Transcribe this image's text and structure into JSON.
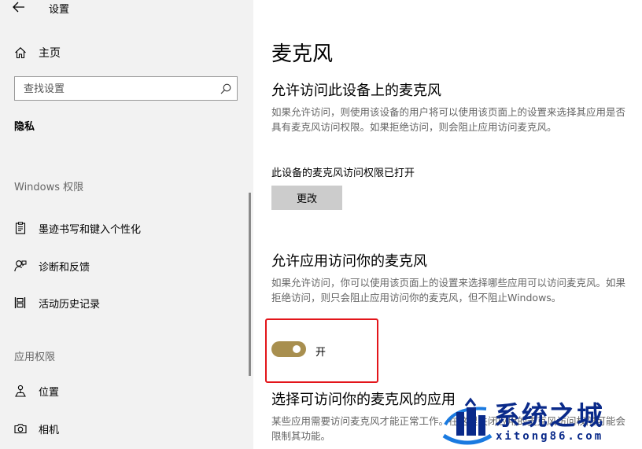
{
  "window": {
    "title": "设置"
  },
  "sidebar": {
    "home_label": "主页",
    "search_placeholder": "查找设置",
    "section_title": "隐私",
    "windows_group_header": "Windows 权限",
    "windows_items": [
      {
        "label": "墨迹书写和键入个性化",
        "icon": "pen-clipboard-icon"
      },
      {
        "label": "诊断和反馈",
        "icon": "feedback-person-icon"
      },
      {
        "label": "活动历史记录",
        "icon": "activity-history-icon"
      }
    ],
    "app_group_header": "应用权限",
    "app_items": [
      {
        "label": "位置",
        "icon": "location-icon"
      },
      {
        "label": "相机",
        "icon": "camera-icon"
      }
    ]
  },
  "main": {
    "page_title": "麦克风",
    "device_section": {
      "heading": "允许访问此设备上的麦克风",
      "description": "如果允许访问，则使用该设备的用户将可以使用该页面上的设置来选择其应用是否具有麦克风访问权限。如果拒绝访问，则会阻止应用访问麦克风。",
      "status": "此设备的麦克风访问权限已打开",
      "change_button": "更改"
    },
    "apps_section": {
      "heading": "允许应用访问你的麦克风",
      "description": "如果允许访问，你可以使用该页面上的设置来选择哪些应用可以访问麦克风。如果拒绝访问，则只会阻止应用访问你的麦克风，但不阻止Windows。",
      "toggle_state": "on",
      "toggle_label": "开"
    },
    "choose_section": {
      "heading": "选择可访问你的麦克风的应用",
      "description": "某些应用需要访问麦克风才能正常工作。在这里关闭应用的麦克风访问权限可能会限制其功能。"
    }
  },
  "watermark": {
    "name": "系统之城",
    "url": "xitong86.com"
  },
  "colors": {
    "toggle_on": "#a88f4f",
    "highlight_border": "#e3151a",
    "watermark": "#0a2a8a"
  }
}
